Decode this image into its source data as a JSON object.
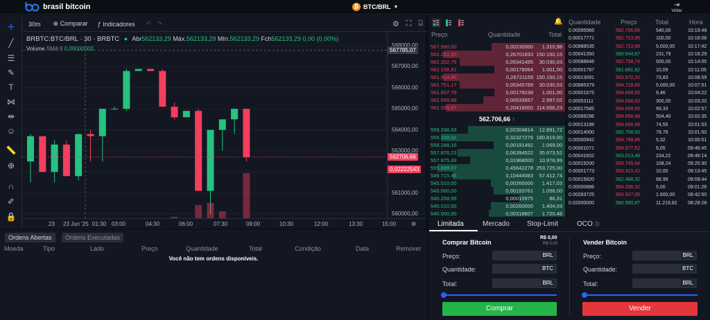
{
  "header": {
    "logo_text": "brasil bitcoin",
    "pair": "BTC/BRL",
    "voltar": "Voltar"
  },
  "chart_toolbar": {
    "interval": "30m",
    "compare": "Comparar",
    "indicators": "Indicadores"
  },
  "legend": {
    "symbol": "BRBTC:BTC/BRL · 30 · BRBTC",
    "open_label": "Abr",
    "open": "562133,29",
    "high_label": "Máx.",
    "high": "562133,29",
    "low_label": "Mín.",
    "low": "562133,29",
    "close_label": "Fch",
    "close": "562133,29",
    "change": "0,00 (0,00%)",
    "volume_label": "Volume",
    "volume_sma": "SMA 9",
    "volume_val": "0,00000000"
  },
  "chart_data": {
    "type": "candlestick",
    "x_labels": [
      "23",
      "23 Jun '25",
      "01:30",
      "03:00",
      "04:30",
      "06:00",
      "07:30",
      "09:00",
      "10:30",
      "12:00",
      "13:30",
      "15:00"
    ],
    "y_ticks": [
      "568000,00",
      "567000,00",
      "566000,00",
      "565000,00",
      "564000,00",
      "563000,00",
      "562000,00",
      "561000,00",
      "560000,00"
    ],
    "ylim": [
      559800,
      568200
    ],
    "candles": [
      [
        562500,
        563800,
        561500,
        563700
      ],
      [
        563700,
        563700,
        562000,
        562000
      ],
      [
        562000,
        563500,
        561500,
        563300
      ],
      [
        563300,
        563500,
        561800,
        561800
      ],
      [
        561800,
        563800,
        561600,
        563800
      ],
      [
        563800,
        564000,
        562500,
        563700
      ],
      [
        563700,
        565000,
        562500,
        565000
      ],
      [
        565000,
        565100,
        565000,
        565000
      ],
      [
        565000,
        566900,
        564900,
        566800
      ],
      [
        566800,
        566900,
        566800,
        566900
      ],
      [
        566900,
        566900,
        566800,
        566800
      ],
      [
        566800,
        566900,
        565100,
        565100
      ],
      [
        565100,
        565300,
        564500,
        564600
      ],
      [
        564600,
        564900,
        564600,
        564900
      ],
      [
        564900,
        565000,
        561100,
        561100
      ],
      [
        561100,
        564000,
        560000,
        564000
      ],
      [
        564000,
        564500,
        563000,
        564500
      ],
      [
        564500,
        565000,
        563800,
        565000
      ],
      [
        565000,
        565000,
        562500,
        562700
      ]
    ],
    "last_price_label": "562706,66",
    "volume_price_label": "0,02222543",
    "last_tag": "567785,07"
  },
  "orderbook": {
    "headers": [
      "Preço",
      "Quantidade",
      "Total"
    ],
    "asks": [
      [
        "567.990,00",
        "0,00230000",
        "1.310,98"
      ],
      [
        "562.231,50",
        "0,26701833",
        "150.150,15"
      ],
      [
        "562.202,75",
        "0,05341495",
        "30.030,03"
      ],
      [
        "562.158,81",
        "0,00178064",
        "1.001,00"
      ],
      [
        "561.914,80",
        "0,26721159",
        "150.150,15"
      ],
      [
        "561.751,17",
        "0,05345789",
        "30.030,03"
      ],
      [
        "561.607,76",
        "0,00178238",
        "1.001,00"
      ],
      [
        "561.599,89",
        "0,00533657",
        "2.997,02"
      ],
      [
        "561.599,87",
        "0,20416000",
        "114.656,23"
      ]
    ],
    "mid": "562.706,66",
    "bids": [
      [
        "559.338,93",
        "0,02304814",
        "12.891,72"
      ],
      [
        "559.338,92",
        "0,32327276",
        "180.819,00"
      ],
      [
        "558.248,16",
        "0,00191492",
        "1.069,00"
      ],
      [
        "557.876,23",
        "0,06394522",
        "35.673,52"
      ],
      [
        "557.875,33",
        "0,01968000",
        "10.978,99"
      ],
      [
        "555.899,07",
        "0,45642278",
        "253.725,00"
      ],
      [
        "549.715,46",
        "0,10444083",
        "57.412,74"
      ],
      [
        "545.010,00",
        "0,00260000",
        "1.417,03"
      ],
      [
        "545.000,00",
        "0,00193761",
        "1.056,00"
      ],
      [
        "540.258,99",
        "0,00015975",
        "86,31"
      ],
      [
        "540.010,00",
        "0,00260000",
        "1.404,03"
      ],
      [
        "540.000,00",
        "0,00318607",
        "1.720,48"
      ]
    ]
  },
  "trades": {
    "headers": [
      "Quantidade",
      "Preço",
      "Total",
      "Hora"
    ],
    "rows": [
      [
        "0.00095965",
        "562.706,66",
        "540,00",
        "10:19:49",
        "r"
      ],
      [
        "0.00017771",
        "562.723,95",
        "100,00",
        "10:18:08",
        "r"
      ],
      [
        "0.00888535",
        "562.723,98",
        "5.000,00",
        "10:17:42",
        "r"
      ],
      [
        "0.00041350",
        "560.544,67",
        "231,79",
        "10:16:29",
        "g"
      ],
      [
        "0.00088848",
        "562.758,74",
        "500,00",
        "10:14:05",
        "r"
      ],
      [
        "0.00001797",
        "561.691,62",
        "10,09",
        "10:11:05",
        "g"
      ],
      [
        "0.00013091",
        "563.970,20",
        "73,83",
        "10:08:59",
        "r"
      ],
      [
        "0.00885379",
        "564.729,69",
        "5.000,00",
        "10:07:51",
        "r"
      ],
      [
        "0.00001675",
        "564.858,55",
        "9,46",
        "10:04:22",
        "r"
      ],
      [
        "0.00053111",
        "564.858,53",
        "300,00",
        "10:03:20",
        "r"
      ],
      [
        "0.00017585",
        "564.858,56",
        "99,33",
        "10:02:57",
        "r"
      ],
      [
        "0.00089296",
        "564.858,48",
        "504,40",
        "10:02:35",
        "r"
      ],
      [
        "0.00013198",
        "564.858,58",
        "74,55",
        "10:01:53",
        "r"
      ],
      [
        "0.00014000",
        "562.708,50",
        "78,78",
        "10:01:50",
        "g"
      ],
      [
        "0.00000942",
        "564.798,86",
        "5,32",
        "10:00:51",
        "r"
      ],
      [
        "0.00001071",
        "564.977,52",
        "6,05",
        "09:46:45",
        "r"
      ],
      [
        "0.00041602",
        "563.013,48",
        "234,22",
        "09:46:14",
        "g"
      ],
      [
        "0.00019200",
        "563.745,54",
        "108,24",
        "09:25:30",
        "r"
      ],
      [
        "0.00001773",
        "563.915,42",
        "10,00",
        "09:13:45",
        "r"
      ],
      [
        "0.00015820",
        "562.498,32",
        "88,99",
        "09:09:44",
        "g"
      ],
      [
        "0.00000886",
        "564.336,32",
        "5,00",
        "09:01:26",
        "r"
      ],
      [
        "0.00283725",
        "563.927,06",
        "1.600,00",
        "08:42:50",
        "r"
      ],
      [
        "0.02000000",
        "560.990,87",
        "11.219,82",
        "08:28:28",
        "g"
      ]
    ]
  },
  "orders": {
    "tabs": [
      "Ordens Abertas",
      "Ordens Executadas"
    ],
    "headers": [
      "Moeda",
      "Tipo",
      "Lado",
      "Preço",
      "Quantidade",
      "Total",
      "Condição",
      "Data",
      "Remover"
    ],
    "empty": "Você não tem ordens disponíveis."
  },
  "form": {
    "tabs": [
      "Limitada",
      "Mercado",
      "Stop-Limit",
      "OCO"
    ],
    "buy_title": "Comprar Bitcoin",
    "buy_balance1": "R$ 0,00",
    "buy_balance2": "R$ 0,00",
    "sell_title": "Vender Bitcoin",
    "price": "Preço:",
    "qty": "Quantidade:",
    "total": "Total:",
    "brl": "BRL",
    "btc": "BTC",
    "buy_btn": "Comprar",
    "sell_btn": "Vender"
  },
  "colors": {
    "up": "#26c281",
    "down": "#f23f5d",
    "buy": "#24b44a",
    "sell": "#e3373d"
  }
}
